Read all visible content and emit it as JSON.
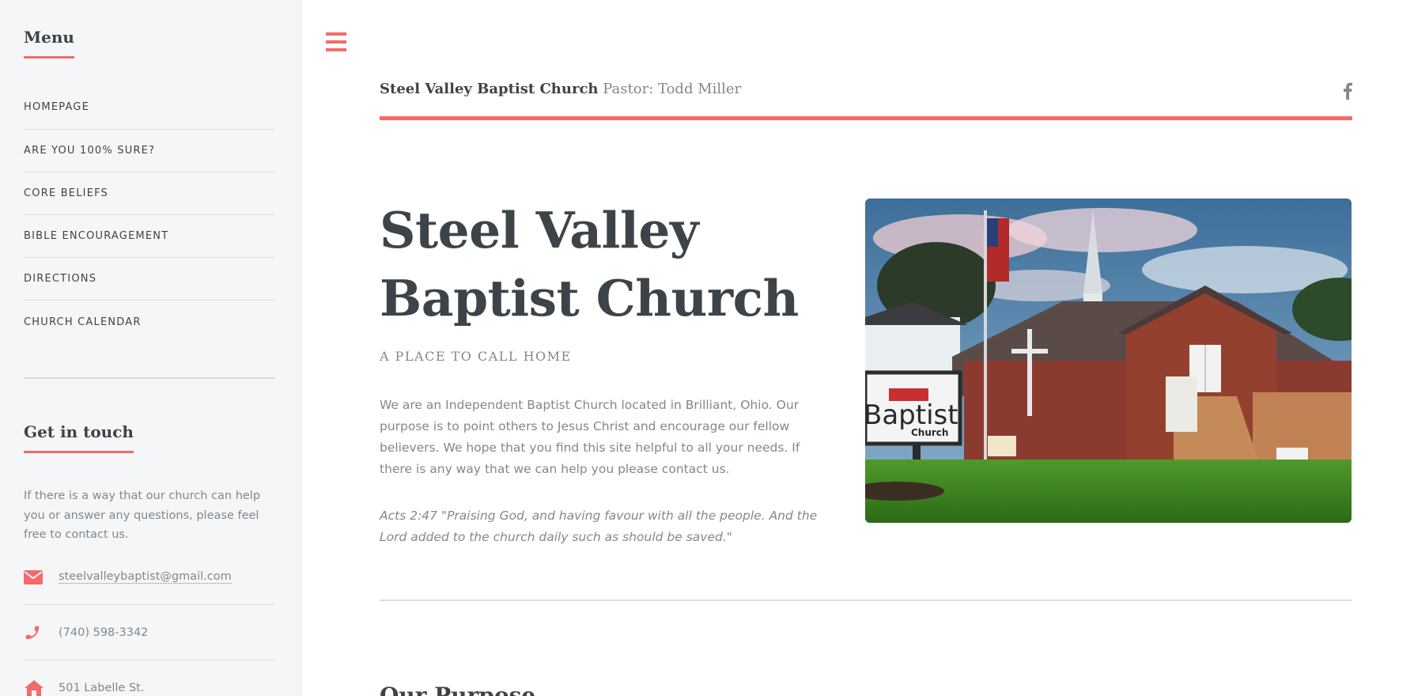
{
  "sidebar": {
    "menu_heading": "Menu",
    "menu_items": [
      {
        "label": "HOMEPAGE"
      },
      {
        "label": "ARE YOU 100% SURE?"
      },
      {
        "label": "CORE BELIEFS"
      },
      {
        "label": "BIBLE ENCOURAGEMENT"
      },
      {
        "label": "DIRECTIONS"
      },
      {
        "label": "CHURCH CALENDAR"
      }
    ],
    "touch_heading": "Get in touch",
    "touch_text": "If there is a way that our church can help you or answer any questions, please feel free to contact us.",
    "contact": {
      "email": "steelvalleybaptist@gmail.com",
      "phone": "(740) 598-3342",
      "address": "501 Labelle St."
    }
  },
  "header": {
    "logo_name": "Steel Valley Baptist Church",
    "logo_pastor": "Pastor: Todd Miller",
    "social_icon": "facebook-icon"
  },
  "banner": {
    "title": "Steel Valley Baptist Church",
    "tagline": "A PLACE TO CALL HOME",
    "intro": "We are an Independent Baptist Church located in Brilliant, Ohio. Our purpose is to point others to Jesus Christ and encourage our fellow believers. We hope that you find this site helpful to all your needs. If there is any way that we can help you please contact us.",
    "verse": "Acts 2:47 \"Praising God, and having favour with all the people. And the Lord added to the church daily such as should be saved.\"",
    "sign_text": "Baptist",
    "sign_sub": "Church"
  },
  "section": {
    "heading": "Our Purpose"
  },
  "colors": {
    "accent": "#f56a6a",
    "text": "#3d4449",
    "muted": "#7f888f",
    "sidebar_bg": "#f5f6f7"
  }
}
